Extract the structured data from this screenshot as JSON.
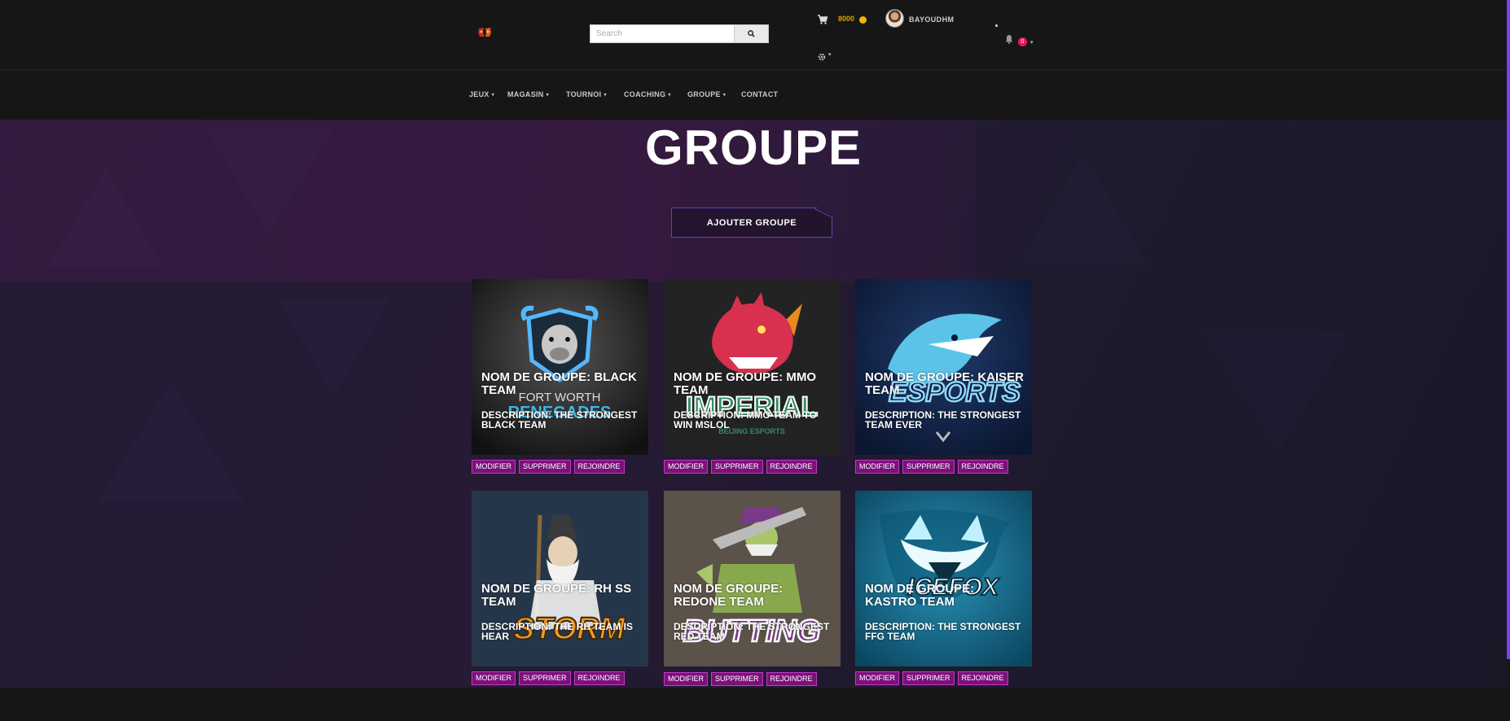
{
  "header": {
    "search": {
      "placeholder": "Search"
    },
    "coins": "8000",
    "username": "BAYOUDHM",
    "notifications": "0"
  },
  "nav": {
    "items": [
      {
        "label": "JEUX",
        "caret": true
      },
      {
        "label": "MAGASIN",
        "caret": true
      },
      {
        "label": "TOURNOI",
        "caret": true
      },
      {
        "label": "COACHING",
        "caret": true
      },
      {
        "label": "GROUPE",
        "caret": true
      },
      {
        "label": "CONTACT",
        "caret": false
      }
    ]
  },
  "page": {
    "title": "GROUPE",
    "add_button": "AJOUTER GROUPE"
  },
  "groups": [
    {
      "name": "NOM DE GROUPE: BLACK TEAM",
      "description": "DESCRIPTION: THE STRONGEST BLACK TEAM",
      "logo": "bull-shield-logo"
    },
    {
      "name": "NOM DE GROUPE: MMO TEAM",
      "description": "DESCRIPTION: MMO TEAM TO WIN MSLOL",
      "logo": "dragon-logo"
    },
    {
      "name": "NOM DE GROUPE: KAISER TEAM",
      "description": "DESCRIPTION: THE STRONGEST TEAM EVER",
      "logo": "shark-logo"
    },
    {
      "name": "NOM DE GROUPE: RH SS TEAM",
      "description": "DESCRIPTION: THE RH TEAM IS HEAR",
      "logo": "wizard-logo"
    },
    {
      "name": "NOM DE GROUPE: REDONE TEAM",
      "description": "DESCRIPTION: THE STRONGEST RED TEAM",
      "logo": "zombie-warrior-logo"
    },
    {
      "name": "NOM DE GROUPE: KASTRO TEAM",
      "description": "DESCRIPTION: THE STRONGEST FFG TEAM",
      "logo": "fox-logo"
    }
  ],
  "card_actions": {
    "modify": "MODIFIER",
    "delete": "SUPPRIMER",
    "join": "REJOINDRE"
  },
  "colors": {
    "accent": "#7b127a",
    "accent_border": "#c23bc3",
    "coin": "#e0a100",
    "badge": "#e9145c",
    "scrollbar": "#7b3ff0"
  }
}
